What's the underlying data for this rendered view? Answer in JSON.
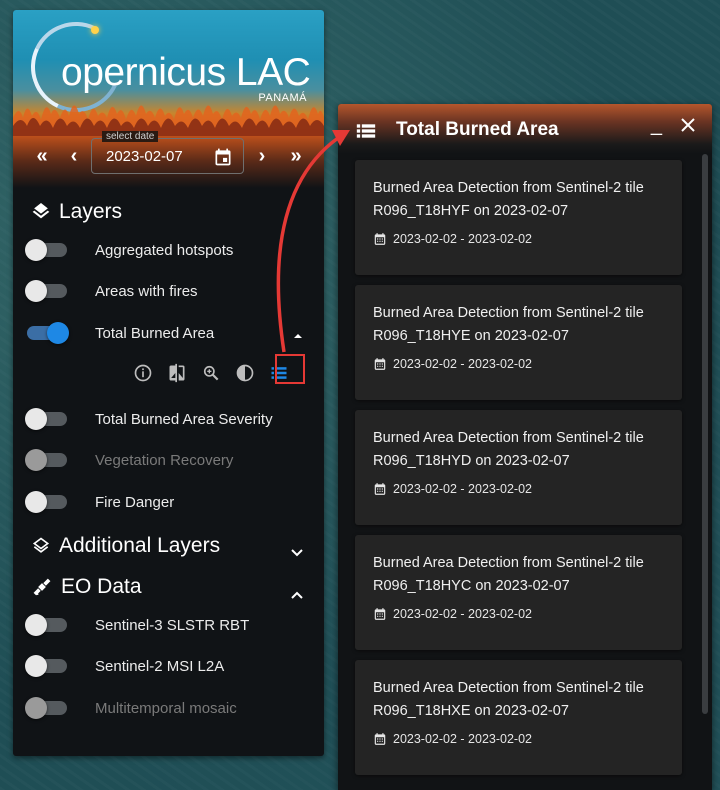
{
  "app": {
    "logo_text": "opernicus LAC",
    "logo_sub": "PANAMÁ"
  },
  "date_picker": {
    "label": "select date",
    "value": "2023-02-07",
    "nav": {
      "first": "«",
      "prev": "‹",
      "next": "›",
      "last": "»"
    }
  },
  "layers": {
    "title": "Layers",
    "items": [
      {
        "label": "Aggregated hotspots",
        "on": false,
        "disabled": false
      },
      {
        "label": "Areas with fires",
        "on": false,
        "disabled": false
      },
      {
        "label": "Total Burned Area",
        "on": true,
        "disabled": false
      },
      {
        "label": "Total Burned Area Severity",
        "on": false,
        "disabled": false
      },
      {
        "label": "Vegetation Recovery",
        "on": false,
        "disabled": true
      },
      {
        "label": "Fire Danger",
        "on": false,
        "disabled": false
      }
    ],
    "tools": [
      "info-icon",
      "compare-icon",
      "zoom-icon",
      "contrast-icon",
      "list-icon"
    ]
  },
  "additional_layers": {
    "title": "Additional Layers"
  },
  "eo_data": {
    "title": "EO Data",
    "items": [
      {
        "label": "Sentinel-3 SLSTR RBT",
        "on": false,
        "disabled": false
      },
      {
        "label": "Sentinel-2 MSI L2A",
        "on": false,
        "disabled": false
      },
      {
        "label": "Multitemporal mosaic",
        "on": false,
        "disabled": true
      }
    ]
  },
  "panel": {
    "title": "Total Burned Area",
    "minimize": "_",
    "cards": [
      {
        "line1": "Burned Area Detection from Sentinel-2 tile",
        "line2": "R096_T18HYF on 2023-02-07",
        "range": "2023-02-02 - 2023-02-02"
      },
      {
        "line1": "Burned Area Detection from Sentinel-2 tile",
        "line2": "R096_T18HYE on 2023-02-07",
        "range": "2023-02-02 - 2023-02-02"
      },
      {
        "line1": "Burned Area Detection from Sentinel-2 tile",
        "line2": "R096_T18HYD on 2023-02-07",
        "range": "2023-02-02 - 2023-02-02"
      },
      {
        "line1": "Burned Area Detection from Sentinel-2 tile",
        "line2": "R096_T18HYC on 2023-02-07",
        "range": "2023-02-02 - 2023-02-02"
      },
      {
        "line1": "Burned Area Detection from Sentinel-2 tile",
        "line2": "R096_T18HXE on 2023-02-07",
        "range": "2023-02-02 - 2023-02-02"
      }
    ]
  },
  "colors": {
    "accent": "#1e88e5",
    "highlight": "#e53935",
    "panel_bg": "#101316",
    "card_bg": "#242424"
  }
}
